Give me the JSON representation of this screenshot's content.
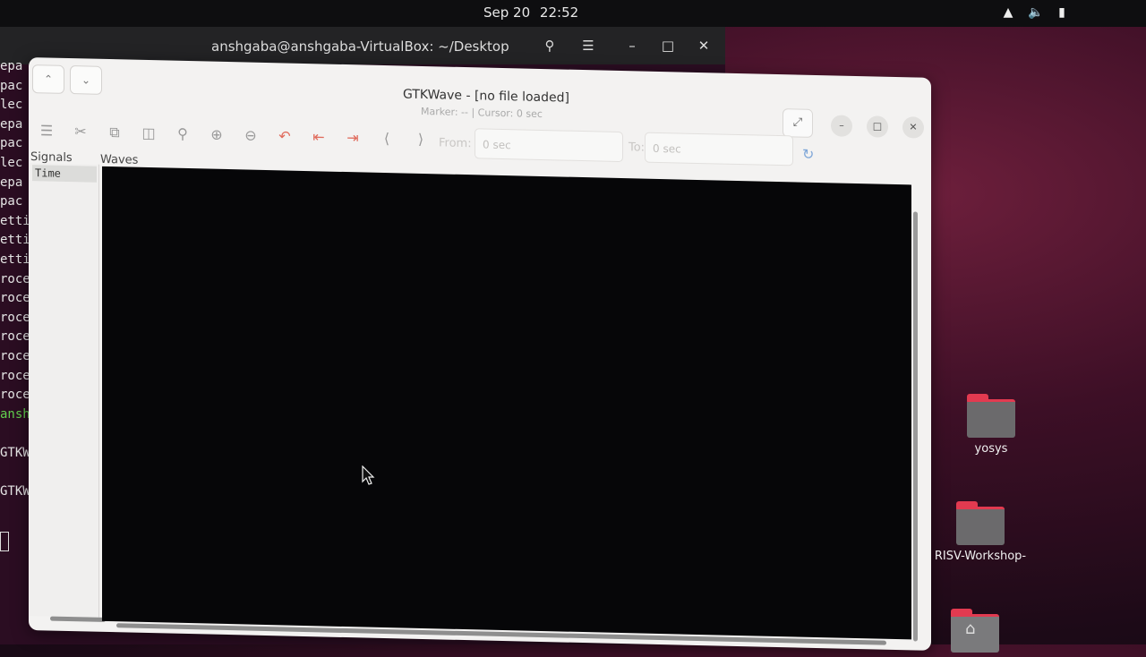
{
  "topbar": {
    "date": "Sep 20",
    "time": "22:52",
    "tray_icons": [
      "network-icon",
      "volume-icon",
      "battery-icon"
    ]
  },
  "terminal": {
    "title": "anshgaba@anshgaba-VirtualBox: ~/Desktop",
    "visible_line_fragments": [
      "epa",
      "pac",
      "lec",
      "epa",
      "pac",
      "lec",
      "epa",
      "pac",
      "etti",
      "etti",
      "etti",
      "roce",
      "roce",
      "roce",
      "roce",
      "roce",
      "roce",
      "roce",
      "anshg",
      "",
      "GTKWa",
      "",
      "GTKWA"
    ]
  },
  "gtkwave": {
    "title": "GTKWave - [no file loaded]",
    "subtitle": "Marker: --  |  Cursor: 0 sec",
    "from_label": "From:",
    "from_value": "0 sec",
    "to_label": "To:",
    "to_value": "0 sec",
    "signals_header": "Signals",
    "waves_header": "Waves",
    "time_signal": "Time"
  },
  "desktop": {
    "icons": [
      {
        "label": "yosys"
      },
      {
        "label": "RISV-Workshop-"
      },
      {
        "label": ""
      }
    ]
  },
  "colors": {
    "wave_background": "#060608",
    "accent_red": "#e23a50",
    "terminal_green": "#62d14e"
  }
}
